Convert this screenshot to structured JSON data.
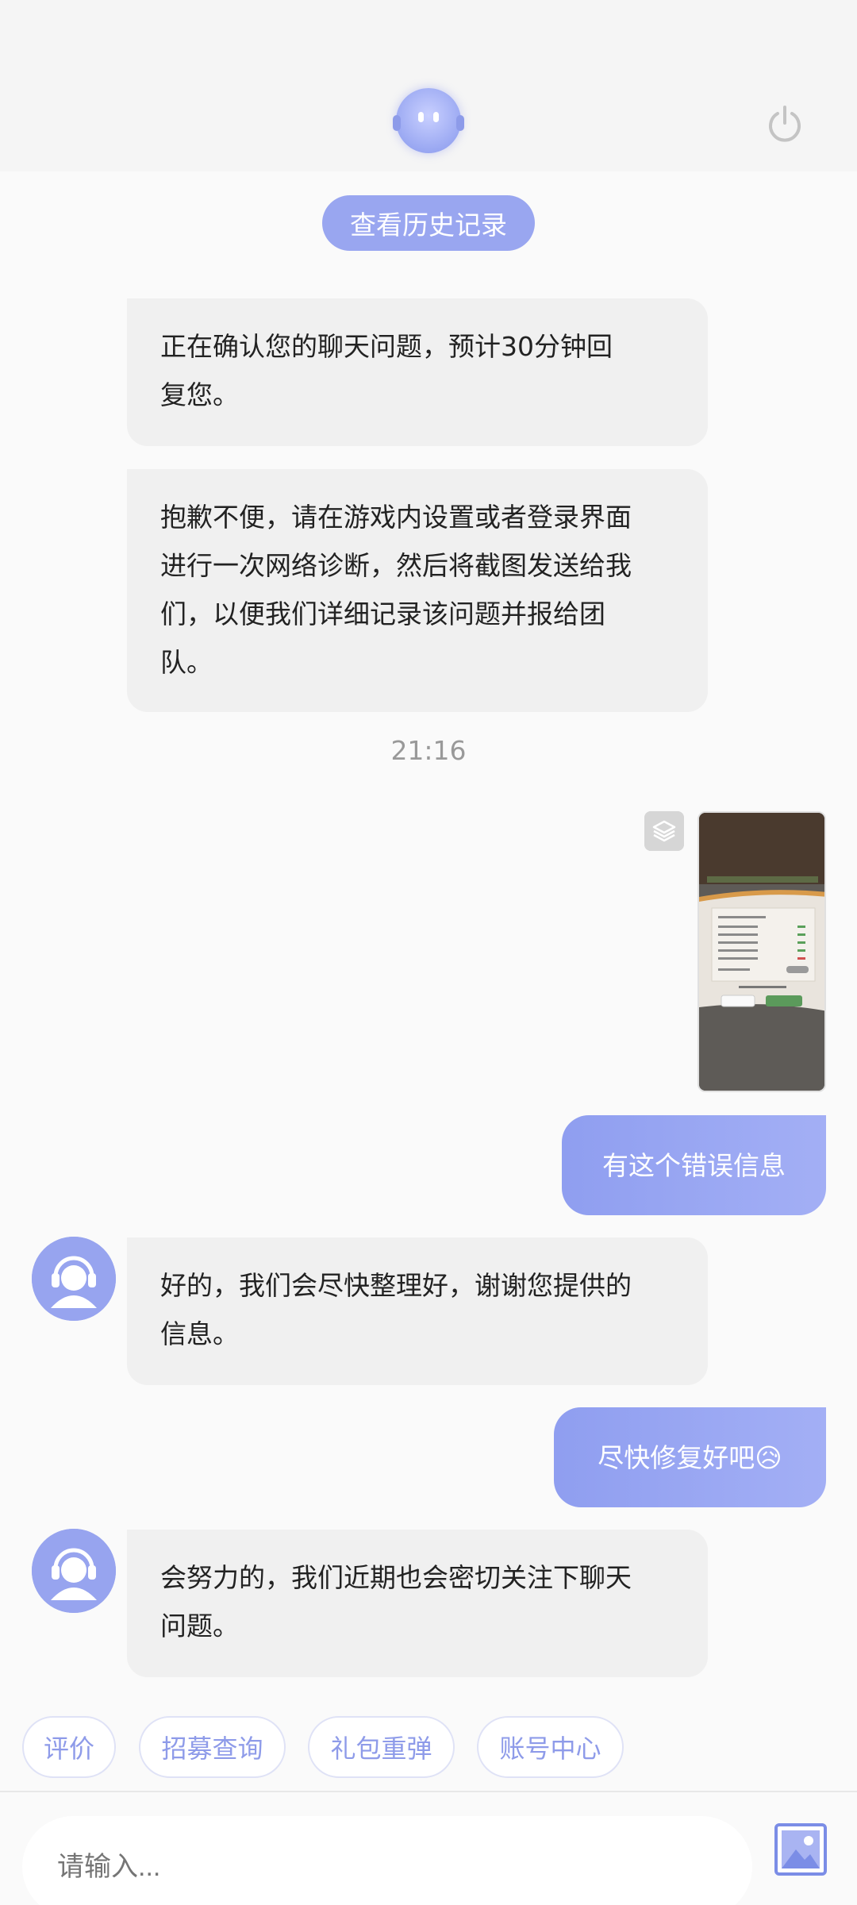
{
  "header": {
    "bot_avatar_icon": "robot-headset-icon",
    "power_icon": "power-icon"
  },
  "history_button_label": "查看历史记录",
  "messages": {
    "bot1_line1": "正在确认您的聊天问题，预计30分钟回",
    "bot1_line2": "复您。",
    "bot2_line1": "抱歉不便，请在游戏内设置或者登录界面",
    "bot2_line2": "进行一次网络诊断，然后将截图发送给我",
    "bot2_line3": "们，以便我们详细记录该问题并报给团",
    "bot2_line4": "队。",
    "timestamp": "21:16",
    "user1": "有这个错误信息",
    "bot3_line1": "好的，我们会尽快整理好，谢谢您提供的",
    "bot3_line2": "信息。",
    "user2": "尽快修复好吧😥",
    "bot4_line1": "会努力的，我们近期也会密切关注下聊天",
    "bot4_line2": "问题。"
  },
  "quick_actions": [
    "评价",
    "招募查询",
    "礼包重弹",
    "账号中心"
  ],
  "input": {
    "placeholder": "请输入..."
  },
  "colors": {
    "accent": "#99a6f0",
    "user_bubble": "#8f9ef0",
    "bot_bubble": "#f0f0f0"
  }
}
